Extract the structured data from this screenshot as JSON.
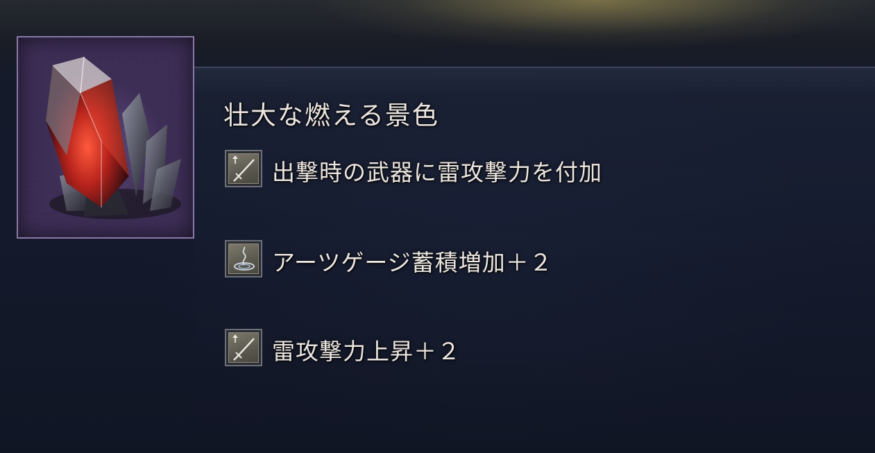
{
  "item": {
    "icon": "red-crystal-icon",
    "name": "壮大な燃える景色"
  },
  "effects": [
    {
      "icon": "sword-up-icon",
      "text": "出撃時の武器に雷攻撃力を付加"
    },
    {
      "icon": "arts-gauge-icon",
      "text": "アーツゲージ蓄積増加＋２"
    },
    {
      "icon": "sword-up-icon",
      "text": "雷攻撃力上昇＋２"
    }
  ],
  "colors": {
    "text": "#ece6e0",
    "frame_border": "#8a7aa8",
    "crystal_red": "#d23a2a"
  }
}
